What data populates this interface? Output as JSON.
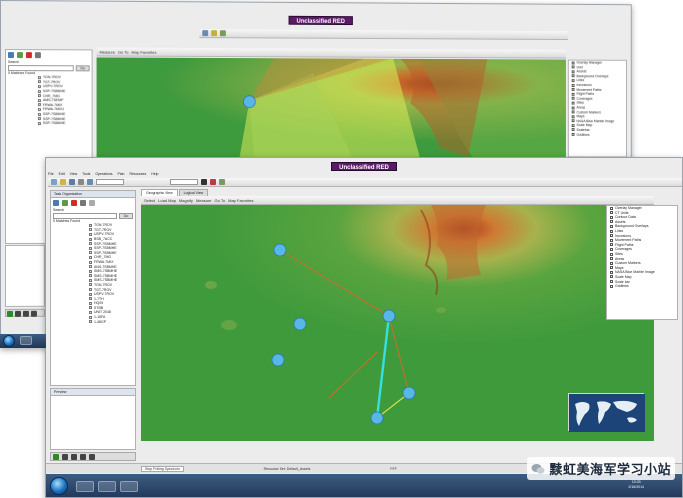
{
  "back_window": {
    "classification": "Unclassified RED",
    "search_label": "Search",
    "go_button": "Go",
    "results_label": "0 Matches Found",
    "tree_items": [
      "TGN-7ROV",
      "TGT-7ROV",
      "USPV-7ROV",
      "SSP-7SBMHE",
      "CHR_7MG",
      "AMS-7SEMP",
      "FRWA-7MIX",
      "FRWA-7MIX1",
      "SSP-7SBMHE",
      "SSP-7SBMHE",
      "SSP-7SBMHE"
    ],
    "overlay_items": [
      "Overlay Manager",
      "Grid",
      "Assets",
      "Background Overlays",
      "Links",
      "Incursions",
      "Movement Paths",
      "Flight Paths",
      "Coverages",
      "Sites",
      "Areas",
      "Custom Markers",
      "Maps",
      "NASA Blue Marble Image",
      "Scale Map",
      "Scalebar",
      "Gridlines"
    ],
    "toolbar_items": [
      "Measure",
      "Go To",
      "Map Favorites"
    ]
  },
  "front_window": {
    "classification": "Unclassified RED",
    "menu_items": [
      "File",
      "Edit",
      "View",
      "Tools",
      "Operations",
      "Plan",
      "Resources",
      "Help"
    ],
    "panel_title": "Task Organization",
    "search_label": "Search",
    "go_button": "Go",
    "results_label": "0 Matches Found",
    "tree_items": [
      "TGN-7ROV",
      "TGT-7ROV",
      "USPV-7ROV",
      "BSB_7ACC",
      "SSP-7SBMHE",
      "SSP-7SBMHE",
      "SSP-7SBMHE",
      "CHR_7MG",
      "FRWA-7MIX",
      "ANS-7SBMHE",
      "SMS-7SBMHE",
      "SMS-7SBMHE",
      "SMS-7SBMHE",
      "TGN-7ROV",
      "TGT-7ROV",
      "USPV-7ROV",
      "1-7TH",
      "HQ09",
      "STBB",
      "UNIT 2048",
      "1-15FA",
      "1-48GP"
    ],
    "preview_label": "Preview",
    "tabs": [
      "Geographic View",
      "Logical View"
    ],
    "map_toolbar": [
      "Select",
      "Load Map",
      "Magnify",
      "Measure",
      "Go To",
      "Map Favorites"
    ],
    "overlay_items": [
      "Overlay Manager",
      "CT Units",
      "Contour Data",
      "Assets",
      "Background Overlays",
      "Links",
      "Incursions",
      "Movement Paths",
      "Flight Paths",
      "Coverages",
      "Sites",
      "Areas",
      "Custom Markers",
      "Maps",
      "NASA Blue Marble Image",
      "Scale Map",
      "Scale bar",
      "Gridlines"
    ],
    "status_text": "Stop Polling Spectrum",
    "status_resource": "Resource Set: Default_Assets",
    "status_right": "FFF",
    "clock_time": "13:33",
    "clock_date": "2/16/2014"
  },
  "watermark": {
    "text": "黩虹美海军学习小站"
  },
  "colors": {
    "classification_bg": "#5b1a66",
    "map_green": "#3f9a3c",
    "node_blue": "#58b7e8",
    "link_orange": "#d06a2a",
    "link_cyan": "#34e0e0",
    "sensor_yellow": "#d8ec52",
    "taskbar": "#26416a"
  }
}
